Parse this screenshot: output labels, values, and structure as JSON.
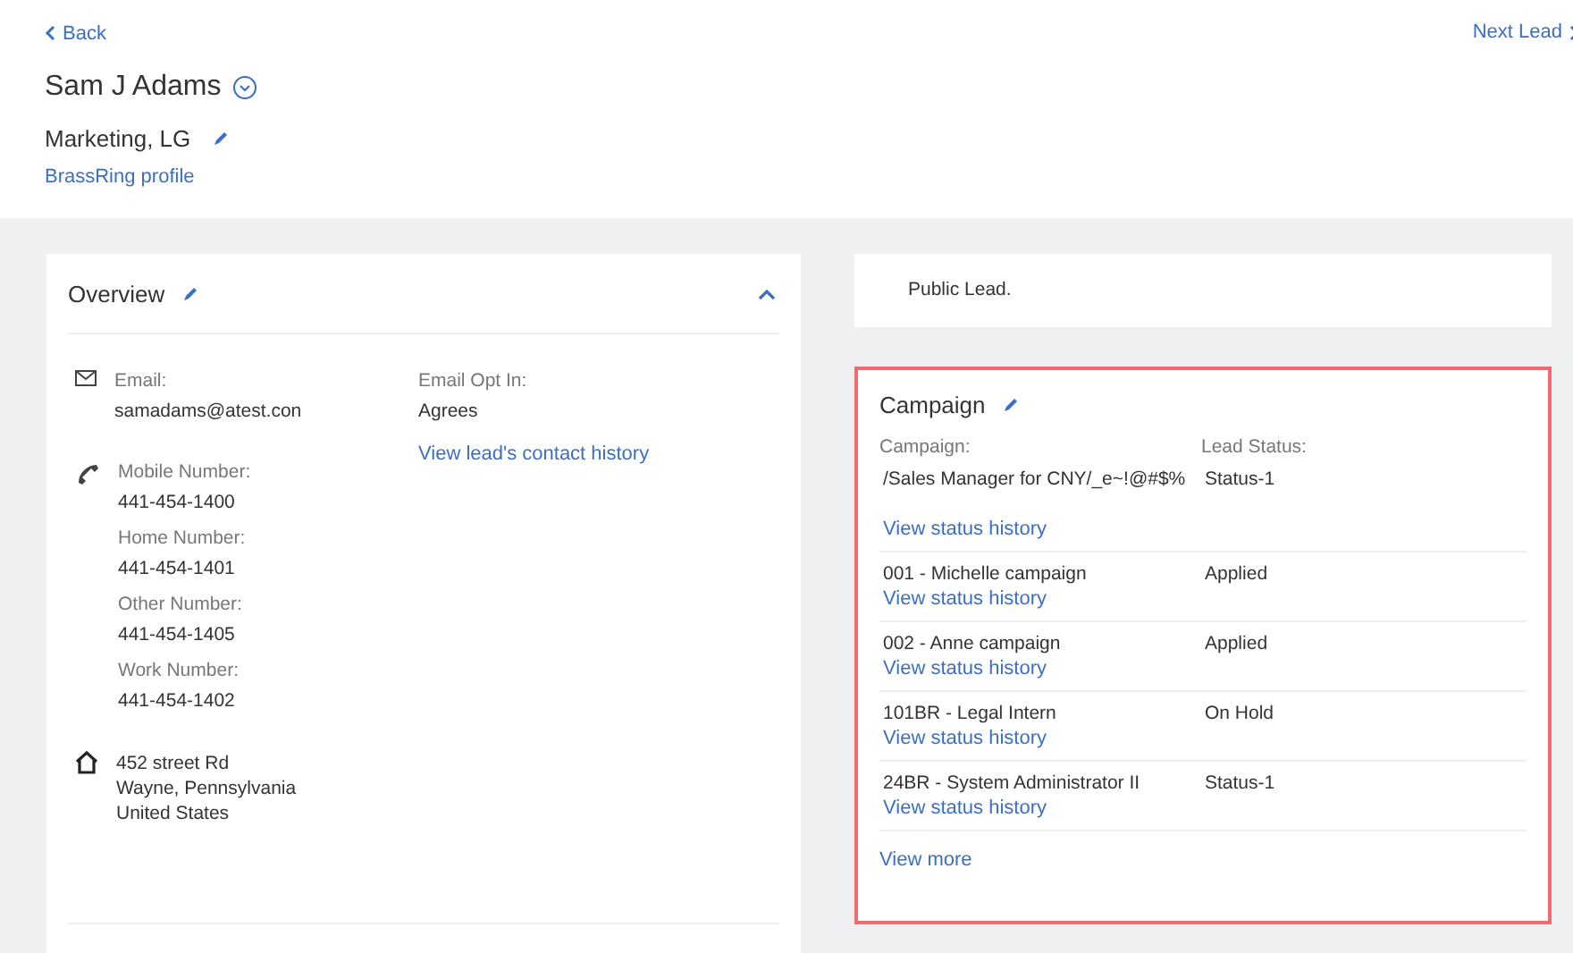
{
  "header": {
    "back": "Back",
    "next": "Next Lead",
    "name": "Sam J Adams",
    "title": "Marketing, LG",
    "profile_link": "BrassRing profile"
  },
  "overview": {
    "title": "Overview",
    "expanded": true,
    "email": {
      "label": "Email:",
      "value": "samadams@atest.con"
    },
    "opt_in": {
      "label": "Email Opt In:",
      "value": "Agrees",
      "link": "View lead's contact history"
    },
    "phones": [
      {
        "label": "Mobile Number:",
        "value": "441-454-1400"
      },
      {
        "label": "Home Number:",
        "value": "441-454-1401"
      },
      {
        "label": "Other Number:",
        "value": "441-454-1405"
      },
      {
        "label": "Work Number:",
        "value": "441-454-1402"
      }
    ],
    "address": [
      "452 street Rd",
      "Wayne, Pennsylvania",
      "United States"
    ]
  },
  "public_lead": "Public Lead.",
  "campaign": {
    "title": "Campaign",
    "highlighted": true,
    "columns": [
      "Campaign:",
      "Lead Status:"
    ],
    "rows": [
      {
        "name": "/Sales Manager for CNY/_e~!@#$%",
        "status": "Status-1",
        "link": "View status history"
      },
      {
        "name": "001 - Michelle campaign",
        "status": "Applied",
        "link": "View status history"
      },
      {
        "name": "002 - Anne campaign",
        "status": "Applied",
        "link": "View status history"
      },
      {
        "name": "101BR - Legal Intern",
        "status": "On Hold",
        "link": "View status history"
      },
      {
        "name": "24BR - System Administrator II",
        "status": "Status-1",
        "link": "View status history"
      }
    ],
    "more": "View more"
  }
}
